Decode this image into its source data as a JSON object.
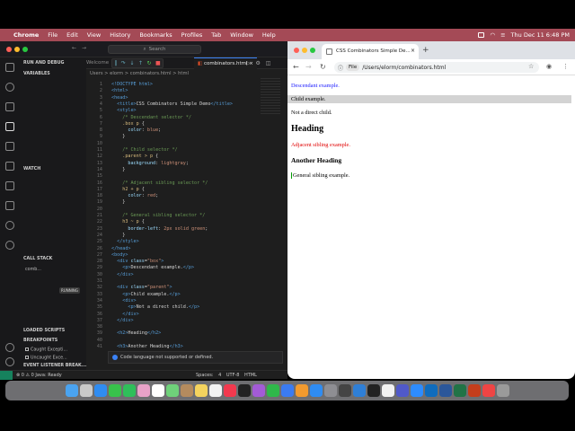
{
  "menubar": {
    "items": [
      "Chrome",
      "File",
      "Edit",
      "View",
      "History",
      "Bookmarks",
      "Profiles",
      "Tab",
      "Window",
      "Help"
    ],
    "datetime": "Thu Dec 11  6:48 PM"
  },
  "vscode": {
    "search_placeholder": "Search",
    "activity_icons": [
      "explorer-icon",
      "search-icon",
      "source-control-icon",
      "run-debug-icon",
      "extensions-icon",
      "remote-icon",
      "test-icon",
      "chart-icon",
      "account-icon",
      "settings-icon"
    ],
    "sidebar": {
      "title": "RUN AND DEBUG",
      "variables": "VARIABLES",
      "watch": "WATCH",
      "call_stack": "CALL STACK",
      "call_stack_item": "comb...",
      "call_stack_state": "RUNNING",
      "loaded_scripts": "LOADED SCRIPTS",
      "breakpoints": "BREAKPOINTS",
      "bp_caught": "Caught Excepti...",
      "bp_uncaught": "Uncaught Exce...",
      "event_listener": "EVENT LISTENER BREAK..."
    },
    "tabs": {
      "welcome": "Welcome",
      "active": "combinators.html"
    },
    "breadcrumb": "Users > elorm >  combinators.html >  html",
    "code_lines": [
      {
        "n": "1",
        "html": "<span class=\"tg\">&lt;!DOCTYPE html&gt;</span>"
      },
      {
        "n": "2",
        "html": "<span class=\"tg\">&lt;html&gt;</span>"
      },
      {
        "n": "3",
        "html": "<span class=\"tg\">&lt;head&gt;</span>"
      },
      {
        "n": "4",
        "html": "  <span class=\"tg\">&lt;title&gt;</span>CSS Combinators Simple Demo<span class=\"tg\">&lt;/title&gt;</span>"
      },
      {
        "n": "5",
        "html": "  <span class=\"tg\">&lt;style&gt;</span>"
      },
      {
        "n": "6",
        "html": "    <span class=\"cm\">/* Descendant selector */</span>"
      },
      {
        "n": "7",
        "html": "    <span class=\"sel\">.box p</span> {"
      },
      {
        "n": "8",
        "html": "      <span class=\"pr\">color</span>: <span class=\"vl\">blue</span>;"
      },
      {
        "n": "9",
        "html": "    }"
      },
      {
        "n": "10",
        "html": ""
      },
      {
        "n": "11",
        "html": "    <span class=\"cm\">/* Child selector */</span>"
      },
      {
        "n": "12",
        "html": "    <span class=\"sel\">.parent &gt; p</span> {"
      },
      {
        "n": "13",
        "html": "      <span class=\"pr\">background</span>: <span class=\"vl\">lightgray</span>;"
      },
      {
        "n": "14",
        "html": "    }"
      },
      {
        "n": "15",
        "html": ""
      },
      {
        "n": "16",
        "html": "    <span class=\"cm\">/* Adjacent sibling selector */</span>"
      },
      {
        "n": "17",
        "html": "    <span class=\"sel\">h2 + p</span> {"
      },
      {
        "n": "18",
        "html": "      <span class=\"pr\">color</span>: <span class=\"vl\">red</span>;"
      },
      {
        "n": "19",
        "html": "    }"
      },
      {
        "n": "20",
        "html": ""
      },
      {
        "n": "21",
        "html": "    <span class=\"cm\">/* General sibling selector */</span>"
      },
      {
        "n": "22",
        "html": "    <span class=\"sel\">h3 ~ p</span> {"
      },
      {
        "n": "23",
        "html": "      <span class=\"pr\">border-left</span>: <span class=\"vl\">2px solid green</span>;"
      },
      {
        "n": "24",
        "html": "    }"
      },
      {
        "n": "25",
        "html": "  <span class=\"tg\">&lt;/style&gt;</span>"
      },
      {
        "n": "26",
        "html": "<span class=\"tg\">&lt;/head&gt;</span>"
      },
      {
        "n": "27",
        "html": "<span class=\"tg\">&lt;body&gt;</span>"
      },
      {
        "n": "28",
        "html": "  <span class=\"tg\">&lt;div</span> <span class=\"at\">class</span>=<span class=\"st\">\"box\"</span><span class=\"tg\">&gt;</span>"
      },
      {
        "n": "29",
        "html": "    <span class=\"tg\">&lt;p&gt;</span>Descendant example.<span class=\"tg\">&lt;/p&gt;</span>"
      },
      {
        "n": "30",
        "html": "  <span class=\"tg\">&lt;/div&gt;</span>"
      },
      {
        "n": "31",
        "html": ""
      },
      {
        "n": "32",
        "html": "  <span class=\"tg\">&lt;div</span> <span class=\"at\">class</span>=<span class=\"st\">\"parent\"</span><span class=\"tg\">&gt;</span>"
      },
      {
        "n": "33",
        "html": "    <span class=\"tg\">&lt;p&gt;</span>Child example.<span class=\"tg\">&lt;/p&gt;</span>"
      },
      {
        "n": "34",
        "html": "    <span class=\"tg\">&lt;div&gt;</span>"
      },
      {
        "n": "35",
        "html": "      <span class=\"tg\">&lt;p&gt;</span>Not a direct child.<span class=\"tg\">&lt;/p&gt;</span>"
      },
      {
        "n": "36",
        "html": "    <span class=\"tg\">&lt;/div&gt;</span>"
      },
      {
        "n": "37",
        "html": "  <span class=\"tg\">&lt;/div&gt;</span>"
      },
      {
        "n": "38",
        "html": ""
      },
      {
        "n": "39",
        "html": "  <span class=\"tg\">&lt;h2&gt;</span>Heading<span class=\"tg\">&lt;/h2&gt;</span>"
      },
      {
        "n": "40",
        "html": ""
      },
      {
        "n": "41",
        "html": "  <span class=\"tg\">&lt;h3&gt;</span>Another Heading<span class=\"tg\">&lt;/h3&gt;</span>"
      }
    ],
    "notification": "Code language not supported or defined.",
    "status_left": "⊗ 0 ⚠ 0   Java: Ready",
    "status_right": "Spaces: 4  UTF-8  HTML"
  },
  "chrome": {
    "tab_title": "CSS Combinators Simple De...",
    "omnibox_chip": "File",
    "url": "/Users/elorm/combinators.html",
    "page": {
      "descendant": "Descendant example.",
      "child": "Child example.",
      "not_direct": "Not a direct child.",
      "heading": "Heading",
      "adjacent": "Adjacent sibling example.",
      "another_heading": "Another Heading",
      "general": "General sibling example."
    }
  },
  "colors": {
    "menubar": "#a44a56",
    "blue_text": "#1a1aff",
    "red_text": "#e00000",
    "lightgray": "#d3d3d3",
    "green_border": "#00a000"
  },
  "dock": {
    "apps": [
      "finder-icon",
      "launchpad-icon",
      "safari-icon",
      "messages-icon",
      "facetime-icon",
      "photos-icon",
      "calendar-icon",
      "maps-icon",
      "contacts-icon",
      "notes-icon",
      "reminders-icon",
      "music-icon",
      "tv-icon",
      "podcasts-icon",
      "numbers-icon",
      "keynote-icon",
      "pages-icon",
      "app-store-icon",
      "settings-icon",
      "iphone-mirroring-icon",
      "vscode-icon",
      "terminal-icon",
      "chrome-icon",
      "teams-icon",
      "zoom-icon",
      "outlook-icon",
      "word-icon",
      "excel-icon",
      "powerpoint-icon",
      "browser-icon",
      "trash-icon"
    ]
  }
}
